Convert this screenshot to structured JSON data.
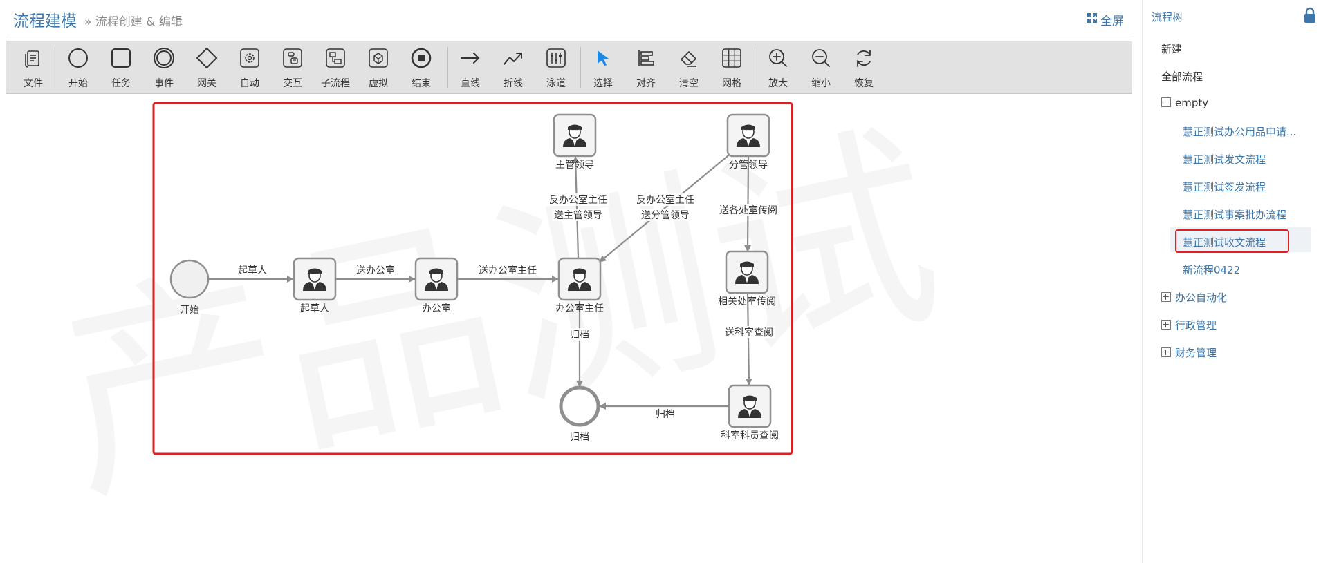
{
  "header": {
    "title": "流程建模",
    "breadcrumb_sep": "»",
    "breadcrumb": "流程创建 & 编辑",
    "fullscreen_label": "全屏"
  },
  "toolbar": [
    {
      "id": "file",
      "label": "文件",
      "icon": "file-icon"
    },
    {
      "id": "start",
      "label": "开始",
      "icon": "start-event-icon"
    },
    {
      "id": "task",
      "label": "任务",
      "icon": "task-icon"
    },
    {
      "id": "event",
      "label": "事件",
      "icon": "intermediate-event-icon"
    },
    {
      "id": "gateway",
      "label": "网关",
      "icon": "gateway-icon"
    },
    {
      "id": "auto",
      "label": "自动",
      "icon": "gear-icon"
    },
    {
      "id": "interact",
      "label": "交互",
      "icon": "interaction-icon"
    },
    {
      "id": "subprocess",
      "label": "子流程",
      "icon": "subprocess-icon"
    },
    {
      "id": "virtual",
      "label": "虚拟",
      "icon": "virtual-icon"
    },
    {
      "id": "end",
      "label": "结束",
      "icon": "end-event-icon"
    },
    {
      "id": "line",
      "label": "直线",
      "icon": "arrow-right-icon"
    },
    {
      "id": "polyline",
      "label": "折线",
      "icon": "polyline-icon"
    },
    {
      "id": "swimlane",
      "label": "泳道",
      "icon": "swimlane-icon"
    },
    {
      "id": "select",
      "label": "选择",
      "icon": "cursor-icon"
    },
    {
      "id": "align",
      "label": "对齐",
      "icon": "align-icon"
    },
    {
      "id": "clear",
      "label": "清空",
      "icon": "eraser-icon"
    },
    {
      "id": "grid",
      "label": "网格",
      "icon": "grid-icon"
    },
    {
      "id": "zoom_in",
      "label": "放大",
      "icon": "zoom-in-icon"
    },
    {
      "id": "zoom_out",
      "label": "缩小",
      "icon": "zoom-out-icon"
    },
    {
      "id": "restore",
      "label": "恢复",
      "icon": "refresh-icon"
    }
  ],
  "diagram": {
    "watermark": "产品测试",
    "nodes": [
      {
        "id": "start",
        "type": "start",
        "label": "开始"
      },
      {
        "id": "drafter",
        "type": "user",
        "label": "起草人"
      },
      {
        "id": "office",
        "type": "user",
        "label": "办公室"
      },
      {
        "id": "office_director",
        "type": "user",
        "label": "办公室主任"
      },
      {
        "id": "chief_leader",
        "type": "user",
        "label": "主管领导"
      },
      {
        "id": "branch_leader",
        "type": "user",
        "label": "分管领导"
      },
      {
        "id": "dept_circulate",
        "type": "user",
        "label": "相关处室传阅"
      },
      {
        "id": "section_review",
        "type": "user",
        "label": "科室科员查阅"
      },
      {
        "id": "archive",
        "type": "end",
        "label": "归档"
      }
    ],
    "edges": [
      {
        "from": "start",
        "to": "drafter",
        "label": [
          "起草人"
        ]
      },
      {
        "from": "drafter",
        "to": "office",
        "label": [
          "送办公室"
        ]
      },
      {
        "from": "office",
        "to": "office_director",
        "label": [
          "送办公室主任"
        ]
      },
      {
        "from": "office_director",
        "to": "chief_leader",
        "label": [
          "反办公室主任",
          "送主管领导"
        ]
      },
      {
        "from": "branch_leader",
        "to": "office_director",
        "label": [
          "反办公室主任",
          "送分管领导"
        ]
      },
      {
        "from": "branch_leader",
        "to": "dept_circulate",
        "label": [
          "送各处室传阅"
        ]
      },
      {
        "from": "dept_circulate",
        "to": "section_review",
        "label": [
          "送科室查阅"
        ]
      },
      {
        "from": "office_director",
        "to": "archive",
        "label": [
          "归档"
        ]
      },
      {
        "from": "section_review",
        "to": "archive",
        "label": [
          "归档"
        ]
      }
    ]
  },
  "panel": {
    "title": "流程树",
    "items": [
      {
        "label": "新建"
      },
      {
        "label": "全部流程"
      },
      {
        "label": "empty",
        "expanded": true
      },
      {
        "label": "慧正测试办公用品申请..."
      },
      {
        "label": "慧正测试发文流程"
      },
      {
        "label": "慧正测试签发流程"
      },
      {
        "label": "慧正测试事案批办流程"
      },
      {
        "label": "慧正测试收文流程",
        "selected": true
      },
      {
        "label": "新流程0422"
      },
      {
        "label": "办公自动化",
        "expanded": false
      },
      {
        "label": "行政管理",
        "expanded": false
      },
      {
        "label": "财务管理",
        "expanded": false
      }
    ]
  },
  "colors": {
    "accent": "#3d76a8",
    "highlight": "#e02020",
    "edge": "#8c8c8c",
    "node_border": "#8f8f8f",
    "select_tool": "#1e88e5"
  }
}
